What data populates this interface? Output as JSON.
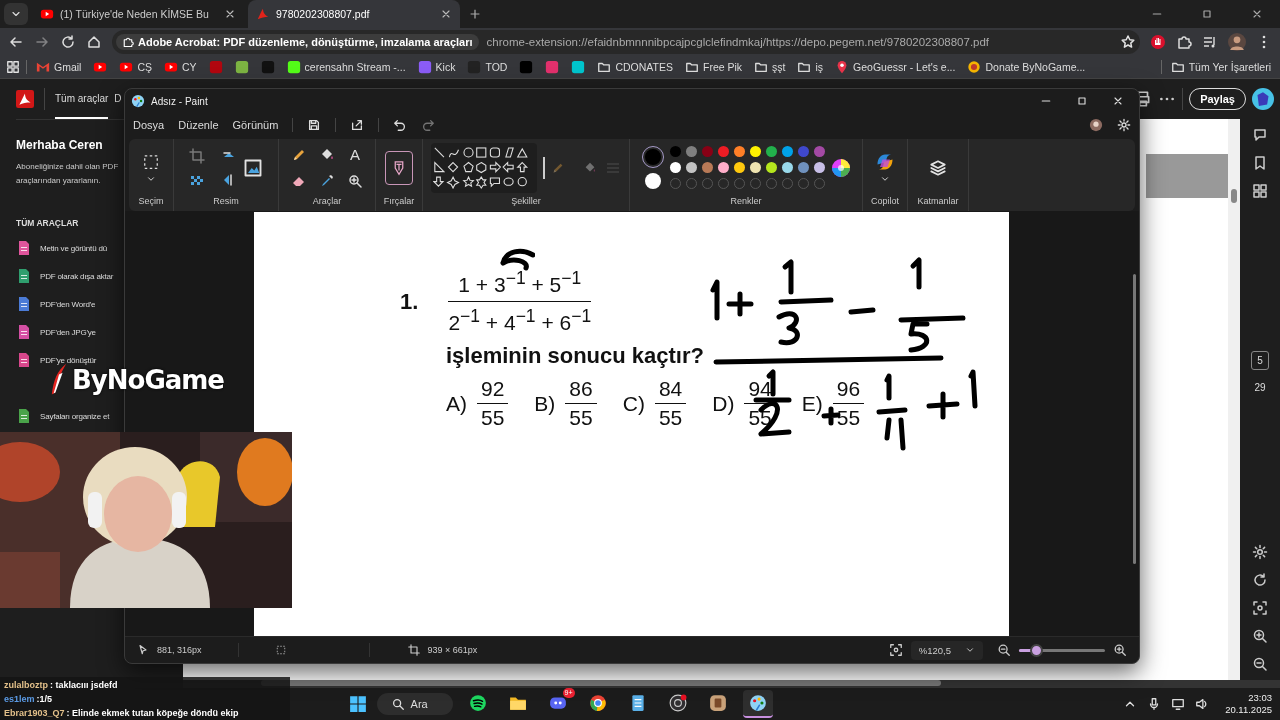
{
  "browser_tabs": [
    {
      "title": "(1) Türkiye'de Neden KİMSE Bu",
      "kind": "video",
      "selected": false
    },
    {
      "title": "9780202308807.pdf",
      "kind": "pdf",
      "selected": true
    }
  ],
  "address_bar": {
    "site": "Adobe Acrobat: PDF düzenleme, dönüştürme, imzalama araçları",
    "url": "chrome-extension://efaidnbmnnnibpcajpcglclefindmkaj/https://depo.pegem.net/9780202308807.pdf"
  },
  "bookmarks": [
    {
      "label": "Gmail",
      "kind": "mail"
    },
    {
      "kind": "play"
    },
    {
      "label": "CŞ",
      "kind": "play"
    },
    {
      "label": "CY",
      "kind": "play"
    },
    {
      "kind": "tile",
      "color": "#b1060f"
    },
    {
      "kind": "tile",
      "color": "#7cb342"
    },
    {
      "kind": "tile",
      "color": "#111111"
    },
    {
      "label": "cerensahn Stream -...",
      "kind": "tile",
      "color": "#53fc18"
    },
    {
      "label": "Kick",
      "kind": "tile",
      "color": "#8b5cf6"
    },
    {
      "label": "TOD",
      "kind": "tile",
      "color": "#222222"
    },
    {
      "kind": "tile",
      "color": "#000000"
    },
    {
      "kind": "tile",
      "color": "#e1306c"
    },
    {
      "kind": "tile",
      "color": "#00c4cc"
    },
    {
      "label": "CDONATES",
      "kind": "folder"
    },
    {
      "label": "Free Pik",
      "kind": "folder"
    },
    {
      "label": "şşt",
      "kind": "folder"
    },
    {
      "label": "iş",
      "kind": "folder"
    },
    {
      "label": "GeoGuessr - Let's e...",
      "kind": "pin"
    },
    {
      "label": "Donate ByNoGame...",
      "kind": "coin"
    }
  ],
  "bookmarks_all": "Tüm Yer İşaretleri",
  "acrobat": {
    "tabs": [
      {
        "label": "Tüm araçlar",
        "selected": true
      },
      {
        "label": "D",
        "selected": false
      }
    ],
    "greeting": "Merhaba Ceren",
    "intro": [
      "Aboneliğinize dahil olan PDF",
      "araçlarından yararlanın."
    ],
    "section": "TÜM ARAÇLAR",
    "tools": [
      {
        "label": "Metin ve görüntü dü",
        "color": "#e0559c"
      },
      {
        "label": "PDF olarak dışa aktar",
        "color": "#2f9e6e"
      },
      {
        "label": "PDF'den Word'e",
        "color": "#4b7bd6"
      },
      {
        "label": "PDF'den JPG'ye",
        "color": "#d44fa3"
      },
      {
        "label": "PDF'ye dönüştür",
        "color": "#d7478b"
      },
      {
        "label": "Sayfaları organize et",
        "color": "#4aa34a"
      }
    ],
    "share": "Paylaş",
    "page_numbers": [
      "5",
      "29"
    ]
  },
  "paint": {
    "title": "Adsız - Paint",
    "menu": [
      "Dosya",
      "Düzenle",
      "Görünüm"
    ],
    "groups": [
      "Seçim",
      "Resim",
      "Araçlar",
      "Fırçalar",
      "Şekiller",
      "Renkler",
      "Copilot",
      "Katmanlar"
    ],
    "text_tool": "A",
    "palette": [
      {
        "color": "#000000"
      },
      {
        "color": "#7f7f7f"
      },
      {
        "color": "#880015"
      },
      {
        "color": "#ed1c24"
      },
      {
        "color": "#ff7f27"
      },
      {
        "color": "#fff200"
      },
      {
        "color": "#22b14c"
      },
      {
        "color": "#00a2e8"
      },
      {
        "color": "#3f48cc"
      },
      {
        "color": "#a349a4"
      },
      {
        "color": "#ffffff"
      },
      {
        "color": "#c3c3c3"
      },
      {
        "color": "#b97a57"
      },
      {
        "color": "#ffaec9"
      },
      {
        "color": "#ffc90e"
      },
      {
        "color": "#efe4b0"
      },
      {
        "color": "#b5e61d"
      },
      {
        "color": "#99d9ea"
      },
      {
        "color": "#7092be"
      },
      {
        "color": "#c8bfe7"
      }
    ],
    "problem": {
      "number": "1.",
      "numerator": "1 + 3$^{−1}$ + 5$^{−1}$",
      "denominator": "2$^{−1}$ + 4$^{−1}$ + 6$^{−1}$",
      "question": "işleminin sonucu kaçtır?",
      "options": [
        {
          "letter": "A)",
          "numerator": "92",
          "denominator": "55"
        },
        {
          "letter": "B)",
          "numerator": "86",
          "denominator": "55"
        },
        {
          "letter": "C)",
          "numerator": "84",
          "denominator": "55"
        },
        {
          "letter": "D)",
          "numerator": "94",
          "denominator": "55"
        },
        {
          "letter": "E)",
          "numerator": "96",
          "denominator": "55"
        }
      ]
    },
    "status": {
      "cursor": "881, 316px",
      "size": "939 × 661px",
      "zoom": "%120,5",
      "level": 0.2
    }
  },
  "overlay_logo": "ByNoGame",
  "chat": [
    {
      "user": "zulalboztp",
      "message": ": taklacııı jsdefd",
      "color": "#e3c08a"
    },
    {
      "user": "es1lem",
      "message": ":1/5",
      "color": "#5b9be6"
    },
    {
      "user": "Ebrar1903_Q7",
      "message": ": Elinde ekmek tutan köpeğe döndü ekip",
      "color": "#e3c08a"
    }
  ],
  "taskbar": {
    "search": "Ara",
    "apps": [
      {
        "kind": "music",
        "selected": false
      },
      {
        "kind": "folder",
        "selected": false
      },
      {
        "kind": "chat",
        "selected": false,
        "badge": "9+"
      },
      {
        "kind": "browser",
        "selected": false
      },
      {
        "kind": "notepad",
        "selected": false
      },
      {
        "kind": "recorder",
        "selected": false
      },
      {
        "kind": "app",
        "selected": false
      },
      {
        "kind": "paint",
        "selected": true
      }
    ],
    "time": "23:03",
    "date": "20.11.2025"
  }
}
